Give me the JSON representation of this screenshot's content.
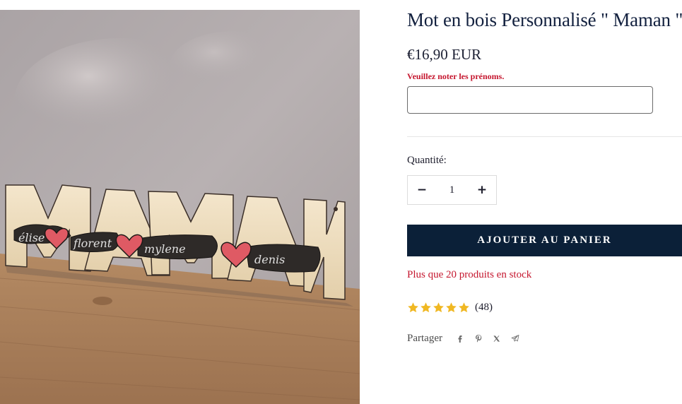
{
  "product": {
    "title": "Mot en bois Personnalisé \" Maman \"",
    "price": "€16,90 EUR",
    "image": {
      "word": "MAMAN",
      "names": [
        "élise",
        "florent",
        "mylene",
        "denis"
      ]
    }
  },
  "personalization": {
    "note": "Veuillez noter les prénoms.",
    "value": "",
    "placeholder": ""
  },
  "quantity": {
    "label": "Quantité:",
    "value": "1",
    "minus": "−",
    "plus": "+"
  },
  "cart": {
    "add_label": "AJOUTER AU PANIER"
  },
  "stock": {
    "text": "Plus que 20 produits en stock"
  },
  "rating": {
    "stars": 5,
    "count": "(48)",
    "star_color": "#f0b823"
  },
  "share": {
    "label": "Partager",
    "icons": [
      "facebook-icon",
      "pinterest-icon",
      "x-icon",
      "telegram-icon"
    ]
  },
  "colors": {
    "button_bg": "#0b2038",
    "alert": "#c5162e",
    "title": "#13213f"
  }
}
